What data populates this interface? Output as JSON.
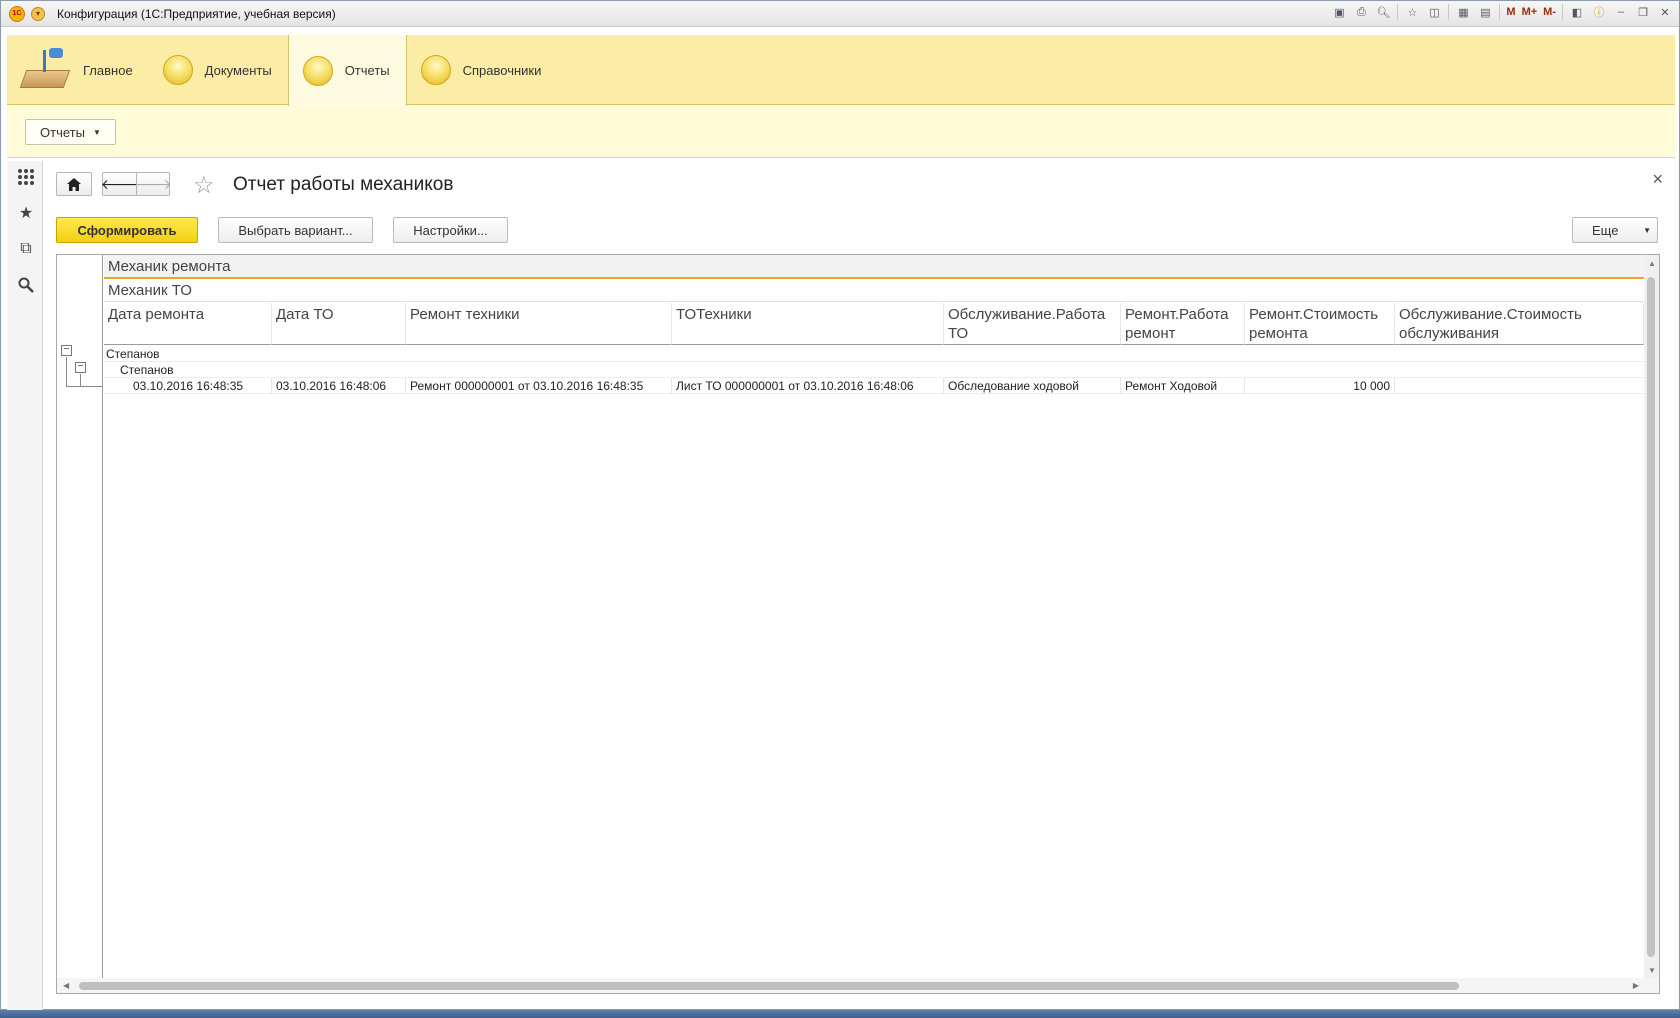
{
  "titlebar": {
    "title": "Конфигурация  (1С:Предприятие, учебная версия)",
    "logo_text": "1С",
    "m_labels": [
      "M",
      "M+",
      "M-"
    ]
  },
  "sections": [
    {
      "label": "Главное",
      "icon": "desk-lamp-icon"
    },
    {
      "label": "Документы",
      "icon": "yellow-circle-icon"
    },
    {
      "label": "Отчеты",
      "icon": "yellow-circle-icon",
      "active": true
    },
    {
      "label": "Справочники",
      "icon": "yellow-circle-icon"
    }
  ],
  "command_bar": {
    "reports_menu_label": "Отчеты"
  },
  "form": {
    "title": "Отчет работы механиков",
    "generate_label": "Сформировать",
    "select_variant_label": "Выбрать вариант...",
    "settings_label": "Настройки...",
    "more_label": "Еще",
    "close_label": "×"
  },
  "report": {
    "group1_header": "Механик ремонта",
    "group2_header": "Механик ТО",
    "columns": [
      "Дата ремонта",
      "Дата ТО",
      "Ремонт техники",
      "ТОТехники",
      "Обслуживание.Работа ТО",
      "Ремонт.Работа ремонт",
      "Ремонт.Стоимость ремонта",
      "Обслуживание.Стоимость обслуживания"
    ],
    "group1_value": "Степанов",
    "group2_value": "Степанов",
    "rows": [
      {
        "repair_date": "03.10.2016 16:48:35",
        "to_date": "03.10.2016 16:48:06",
        "repair_doc": "Ремонт 000000001 от 03.10.2016 16:48:35",
        "to_doc": "Лист ТО 000000001 от 03.10.2016 16:48:06",
        "service_work": "Обследование ходовой",
        "repair_work": "Ремонт Ходовой",
        "repair_cost": "10 000",
        "service_cost": ""
      }
    ]
  },
  "colors": {
    "sections_bg": "#fbeda5",
    "active_section_bg": "#fffbe0",
    "primary_button": "#f2cf13",
    "header_underline": "#f0a524"
  }
}
